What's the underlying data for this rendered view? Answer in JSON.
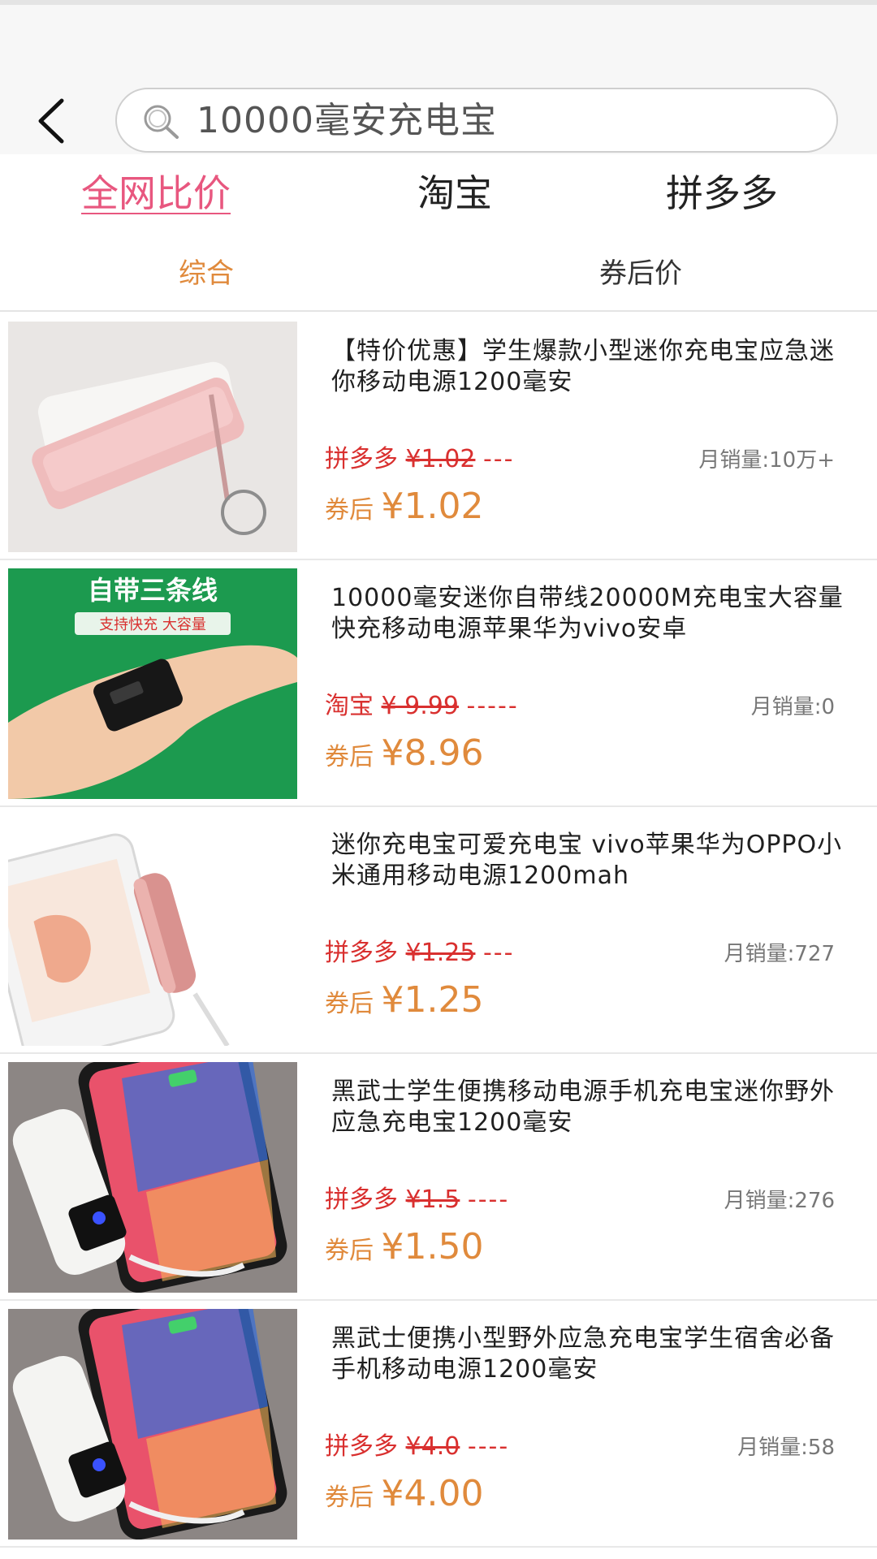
{
  "search": {
    "query": "10000毫安充电宝"
  },
  "platform_tabs": [
    {
      "label": "全网比价",
      "active": true
    },
    {
      "label": "淘宝",
      "active": false
    },
    {
      "label": "拼多多",
      "active": false
    }
  ],
  "sort_tabs": [
    {
      "label": "综合",
      "active": true
    },
    {
      "label": "券后价",
      "active": false
    }
  ],
  "products": [
    {
      "title": "【特价优惠】学生爆款小型迷你充电宝应急迷你移动电源1200毫安",
      "platform": "拼多多",
      "original_price": "¥1.02",
      "dashes": "---",
      "sales": "月销量:10万+",
      "after_label": "券后",
      "after_price": "¥1.02",
      "image": "pink-power-bank"
    },
    {
      "title": "10000毫安迷你自带线20000M充电宝大容量快充移动电源苹果华为vivo安卓",
      "platform": "淘宝",
      "original_price": "¥ 9.99",
      "dashes": "-----",
      "sales": "月销量:0",
      "after_label": "券后",
      "after_price": "¥8.96",
      "image": "hand-power-bank",
      "image_text": {
        "headline": "自带三条线",
        "tagline": "支持快充   大容量"
      }
    },
    {
      "title": "迷你充电宝可爱充电宝 vivo苹果华为OPPO小米通用移动电源1200mah",
      "platform": "拼多多",
      "original_price": "¥1.25",
      "dashes": "---",
      "sales": "月销量:727",
      "after_label": "券后",
      "after_price": "¥1.25",
      "image": "phone-with-tube-power-bank"
    },
    {
      "title": "黑武士学生便携移动电源手机充电宝迷你野外应急充电宝1200毫安",
      "platform": "拼多多",
      "original_price": "¥1.5",
      "dashes": "----",
      "sales": "月销量:276",
      "after_label": "券后",
      "after_price": "¥1.50",
      "image": "phone-with-white-power-bank"
    },
    {
      "title": "黑武士便携小型野外应急充电宝学生宿舍必备手机移动电源1200毫安",
      "platform": "拼多多",
      "original_price": "¥4.0",
      "dashes": "----",
      "sales": "月销量:58",
      "after_label": "券后",
      "after_price": "¥4.00",
      "image": "phone-with-white-power-bank"
    }
  ],
  "colors": {
    "accent_pink": "#e8577f",
    "accent_orange": "#e08a3c",
    "price_red": "#d9302f"
  }
}
